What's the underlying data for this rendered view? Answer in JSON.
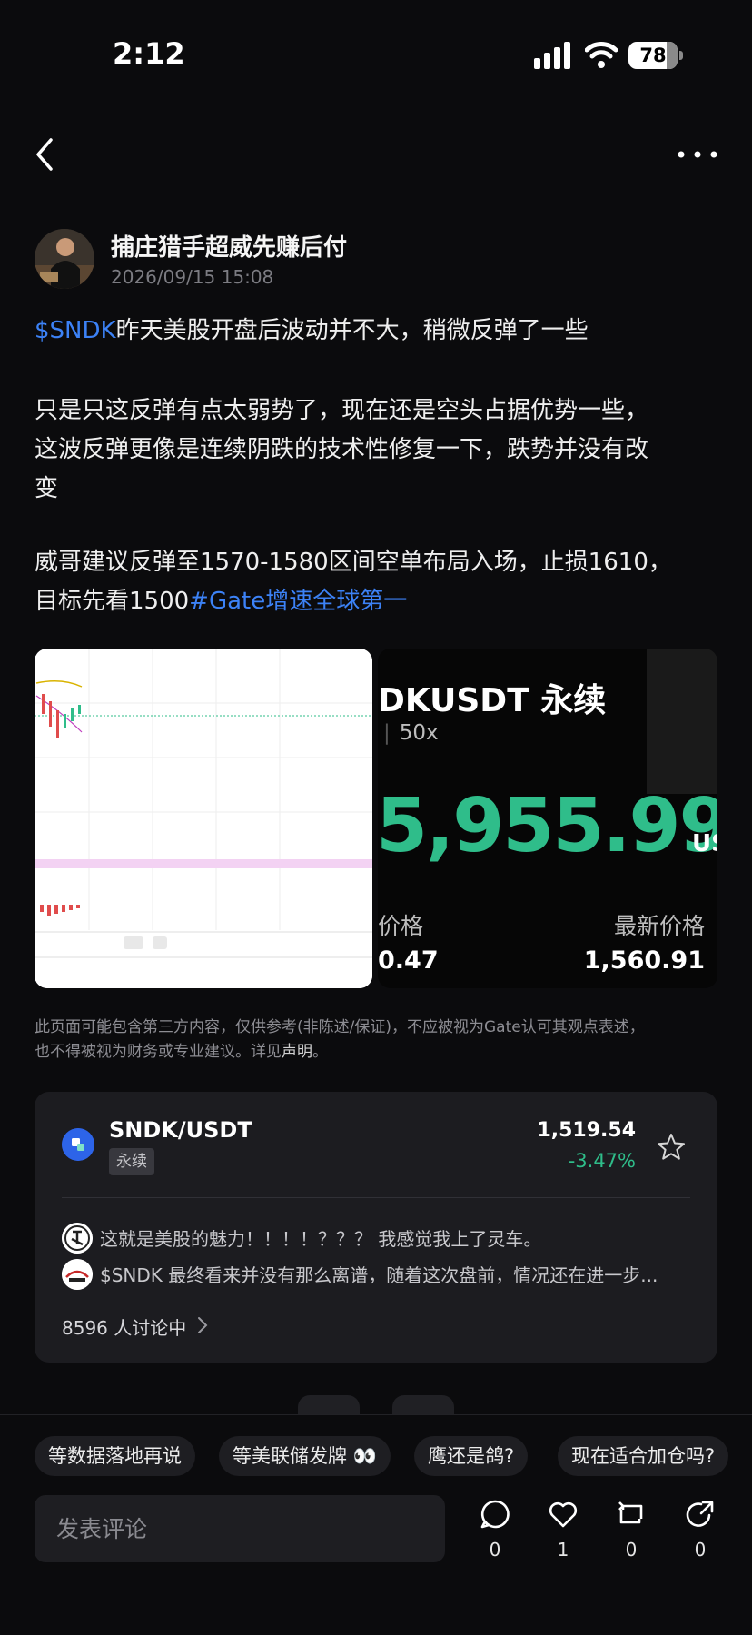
{
  "status_bar": {
    "time": "2:12",
    "battery": "78",
    "battery_level": 0.78
  },
  "post": {
    "author": "捕庄猎手超威先赚后付",
    "timestamp": "2026/09/15 15:08",
    "para1_tag": "$SNDK",
    "para1_text": "昨天美股开盘后波动并不大，稍微反弹了一些",
    "para2_line1": "只是只这反弹有点太弱势了，现在还是空头占据优势一些，",
    "para2_line2": "这波反弹更像是连续阴跌的技术性修复一下，跌势并没有改",
    "para2_line3": "变",
    "para3_line1": "威哥建议反弹至1570-1580区间空单布局入场，止损1610，",
    "para3_line2": "目标先看1500",
    "para3_tag": "#Gate增速全球第一"
  },
  "image2": {
    "pair": "DKUSDT 永续",
    "leverage": "50x",
    "big_price": "5,955.99",
    "big_price_suffix": "US",
    "label_left": "价格",
    "label_right": "最新价格",
    "value_left": "0.47",
    "value_right": "1,560.91"
  },
  "disclaimer": {
    "line1": "此页面可能包含第三方内容，仅供参考(非陈述/保证)，不应被视为Gate认可其观点表述，",
    "line2": "也不得被视为财务或专业建议。详见",
    "link": "声明",
    "end": "。"
  },
  "market_card": {
    "pair": "SNDK/USDT",
    "badge": "永续",
    "price": "1,519.54",
    "change": "-3.47%",
    "comments": [
      "这就是美股的魅力！！！！？？？  我感觉我上了灵车。",
      "$SNDK  最终看来并没有那么离谱，随着这次盘前，情况还在进一步..."
    ],
    "discussing": "8596 人讨论中"
  },
  "chips": [
    "等数据落地再说",
    "等美联储发牌 👀",
    "鹰还是鸽?",
    "现在适合加仓吗?"
  ],
  "comment_input": {
    "placeholder": "发表评论"
  },
  "actions": {
    "comment": "0",
    "like": "1",
    "repost": "0",
    "share": "0"
  },
  "colors": {
    "accent_blue": "#3c82f6",
    "up_green": "#2fbd8a",
    "background": "#0b0b0d"
  }
}
